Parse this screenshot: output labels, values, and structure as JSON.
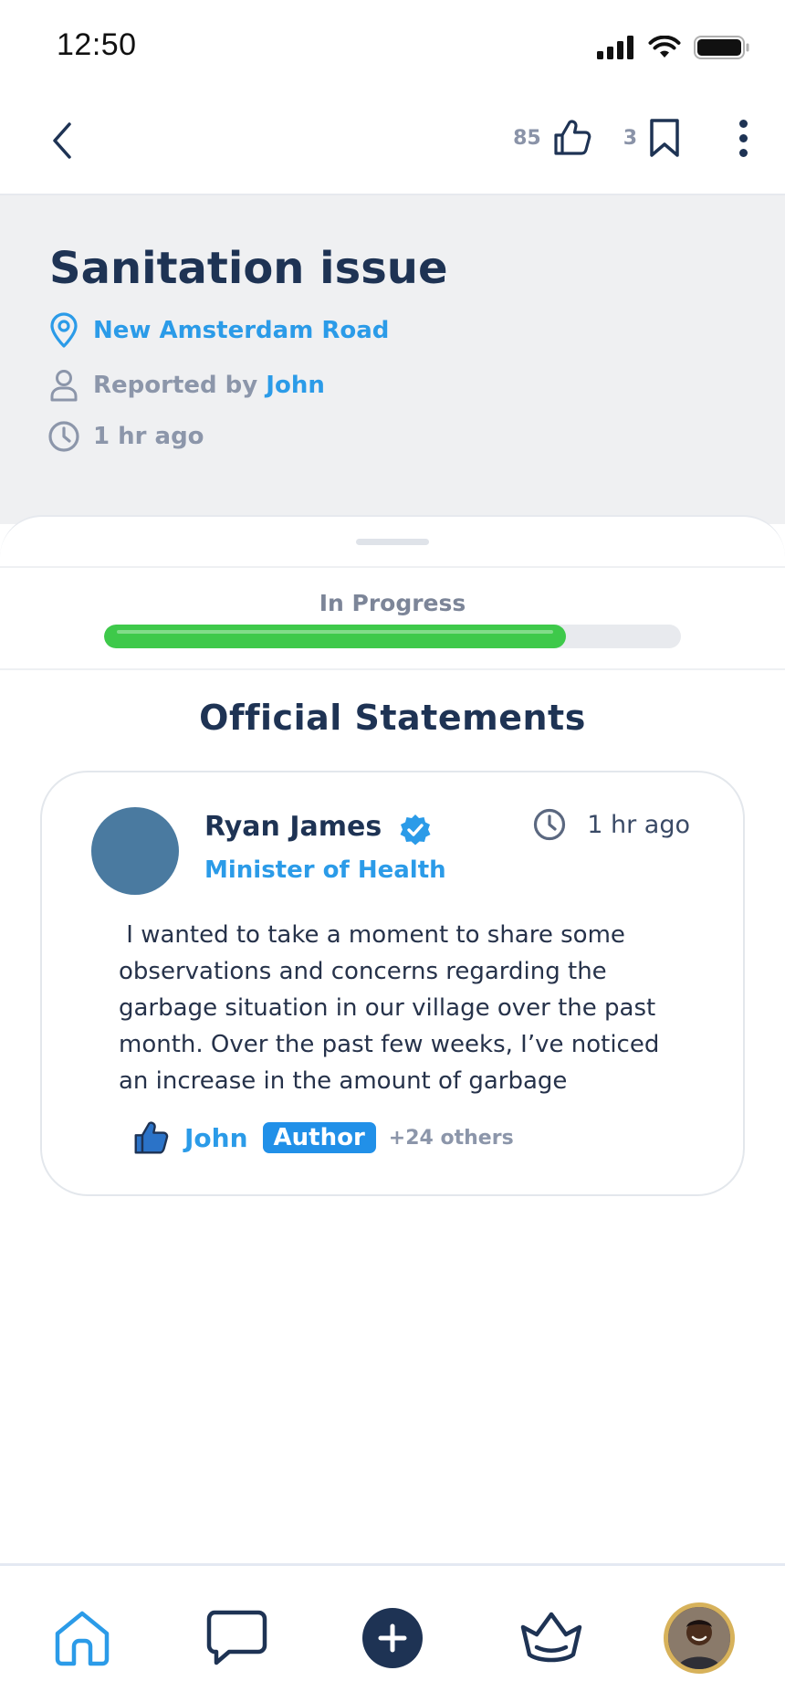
{
  "status_bar": {
    "time": "12:50"
  },
  "top_nav": {
    "like_count": "85",
    "bookmark_count": "3"
  },
  "issue": {
    "title": "Sanitation issue",
    "location": "New Amsterdam Road",
    "reported_by_label": "Reported by ",
    "reporter": "John",
    "time": "1 hr ago"
  },
  "progress": {
    "label": "In Progress",
    "fraction": 0.8,
    "color": "#3ec94a"
  },
  "section_title": "Official Statements",
  "statement": {
    "author": "Ryan James",
    "role": "Minister of Health",
    "time": "1 hr ago",
    "body": " I wanted to take a moment to share some observations and concerns regarding the garbage situation in our village over the past month. Over the past few weeks, I’ve noticed an increase in the amount of garbage",
    "liker": "John",
    "liker_badge": "Author",
    "others": "+24 others"
  },
  "colors": {
    "primary": "#1e3354",
    "accent": "#2b9be8",
    "muted": "#8c96aa"
  },
  "icons": [
    "back-chevron-icon",
    "thumbs-up-icon",
    "bookmark-icon",
    "more-vertical-icon",
    "location-pin-icon",
    "user-icon",
    "clock-icon",
    "verified-badge-icon",
    "home-icon",
    "chat-icon",
    "plus-icon",
    "crown-icon"
  ]
}
